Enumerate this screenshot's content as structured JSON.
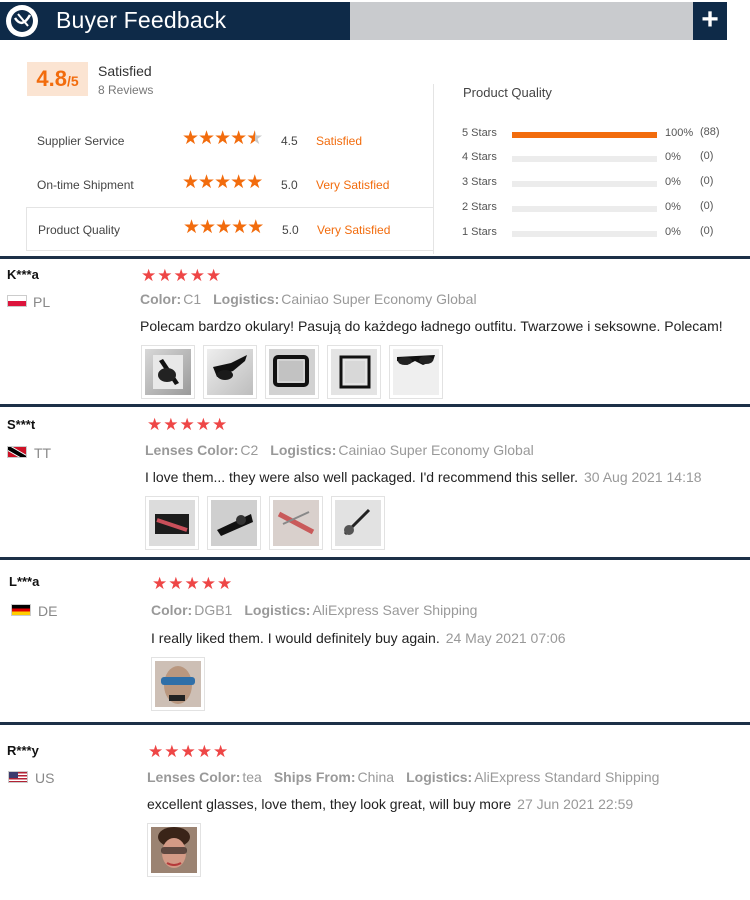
{
  "header": {
    "title": "Buyer Feedback",
    "add_label": "+"
  },
  "summary": {
    "score": "4.8",
    "score_denominator": "/5",
    "satisfaction": "Satisfied",
    "reviews_count": "8 Reviews",
    "sub_ratings": [
      {
        "label": "Supplier Service",
        "value": "4.5",
        "word": "Satisfied",
        "rating": 4.5
      },
      {
        "label": "On-time Shipment",
        "value": "5.0",
        "word": "Very Satisfied",
        "rating": 5.0
      },
      {
        "label": "Product Quality",
        "value": "5.0",
        "word": "Very Satisfied",
        "rating": 5.0
      }
    ],
    "breakdown_title": "Product Quality",
    "breakdown": [
      {
        "label": "5 Stars",
        "pct": "100%",
        "count": "(88)",
        "fraction": 1.0
      },
      {
        "label": "4 Stars",
        "pct": "0%",
        "count": "(0)",
        "fraction": 0
      },
      {
        "label": "3 Stars",
        "pct": "0%",
        "count": "(0)",
        "fraction": 0
      },
      {
        "label": "2 Stars",
        "pct": "0%",
        "count": "(0)",
        "fraction": 0
      },
      {
        "label": "1 Stars",
        "pct": "0%",
        "count": "(0)",
        "fraction": 0
      }
    ],
    "colors": {
      "accent": "#f26c0d",
      "header": "#0e2a48"
    }
  },
  "reviews": [
    {
      "name": "K***a",
      "country": "PL",
      "stars": "★★★★★",
      "meta": [
        {
          "key": "Color:",
          "value": "C1"
        },
        {
          "key": "Logistics:",
          "value": "Cainiao Super Economy Global"
        }
      ],
      "text": "Polecam bardzo okulary! Pasują do każdego ładnego outfitu. Twarzowe i seksowne. Polecam!",
      "date": ""
    },
    {
      "name": "S***t",
      "country": "TT",
      "stars": "★★★★★",
      "meta": [
        {
          "key": "Lenses Color:",
          "value": "C2"
        },
        {
          "key": "Logistics:",
          "value": "Cainiao Super Economy Global"
        }
      ],
      "text": "I love them... they were also well packaged. I'd recommend this seller.",
      "date": "30 Aug 2021 14:18"
    },
    {
      "name": "L***a",
      "country": "DE",
      "stars": "★★★★★",
      "meta": [
        {
          "key": "Color:",
          "value": "DGB1"
        },
        {
          "key": "Logistics:",
          "value": "AliExpress Saver Shipping"
        }
      ],
      "text": "I really liked them. I would definitely buy again.",
      "date": "24 May 2021 07:06"
    },
    {
      "name": "R***y",
      "country": "US",
      "stars": "★★★★★",
      "meta": [
        {
          "key": "Lenses Color:",
          "value": "tea"
        },
        {
          "key": "Ships From:",
          "value": "China"
        },
        {
          "key": "Logistics:",
          "value": "AliExpress Standard Shipping"
        }
      ],
      "text": "excellent glasses, love them, they look great, will buy more",
      "date": "27 Jun 2021 22:59"
    }
  ]
}
